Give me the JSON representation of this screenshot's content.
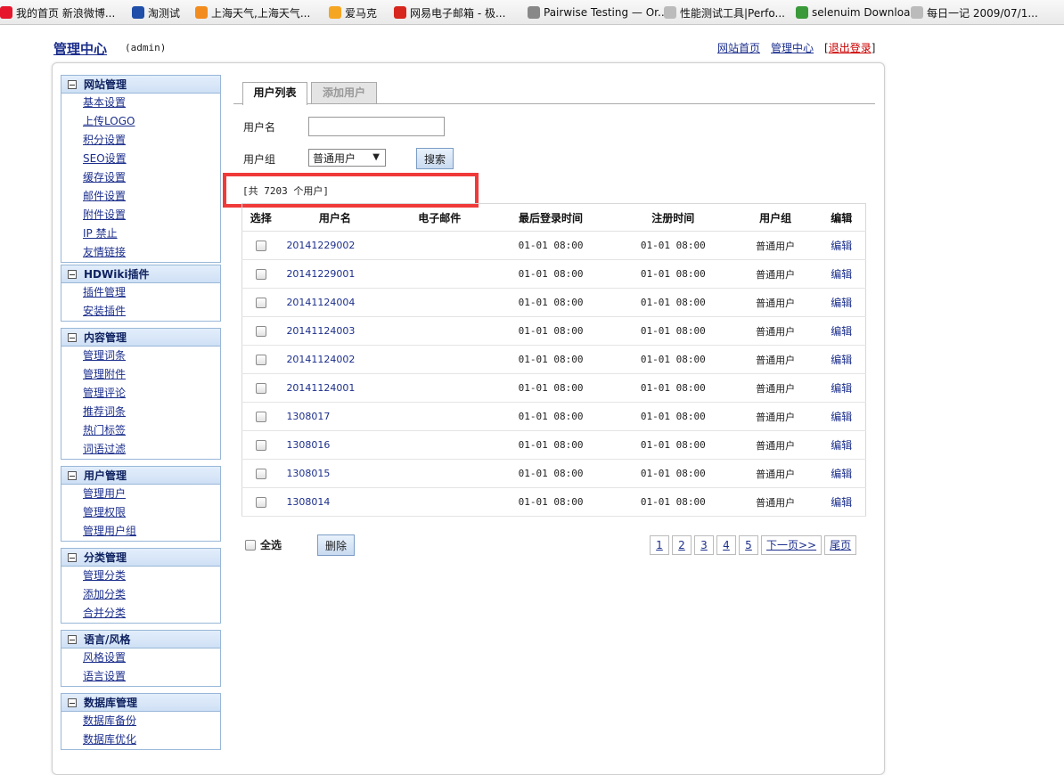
{
  "bookmarks": [
    {
      "label": "我的首页 新浪微博...",
      "icon": "weibo-icon",
      "color": "#e6162d"
    },
    {
      "label": "淘测试",
      "icon": "taobao-icon",
      "color": "#1f4fa8"
    },
    {
      "label": "上海天气,上海天气...",
      "icon": "weather-icon",
      "color": "#f28c1e"
    },
    {
      "label": "爱马克",
      "icon": "amark-icon",
      "color": "#f5a623"
    },
    {
      "label": "网易电子邮箱 - 极...",
      "icon": "netease-icon",
      "color": "#d6261e"
    },
    {
      "label": "Pairwise Testing — Or...",
      "icon": "pairwise-icon",
      "color": "#888888"
    },
    {
      "label": "性能测试工具|Perfo...",
      "icon": "page-icon",
      "color": "#bbbbbb"
    },
    {
      "label": "selenuim Downloads",
      "icon": "check-icon",
      "color": "#3a9a3a"
    },
    {
      "label": "每日一记 2009/07/1...",
      "icon": "page-icon",
      "color": "#bbbbbb"
    }
  ],
  "header": {
    "title": "管理中心",
    "user": "(admin)",
    "links": {
      "home": "网站首页",
      "admin": "管理中心",
      "bracket_open": "[",
      "logout": "退出登录",
      "bracket_close": "]"
    }
  },
  "sidebar": [
    {
      "title": "网站管理",
      "items": [
        "基本设置",
        "上传LOGO",
        "积分设置",
        "SEO设置",
        "缓存设置",
        "邮件设置",
        "附件设置",
        "IP 禁止",
        "友情链接"
      ]
    },
    {
      "title": "HDWiki插件",
      "items": [
        "插件管理",
        "安装插件"
      ]
    },
    {
      "title": "内容管理",
      "items": [
        "管理词条",
        "管理附件",
        "管理评论",
        "推荐词条",
        "热门标签",
        "词语过滤"
      ]
    },
    {
      "title": "用户管理",
      "items": [
        "管理用户",
        "管理权限",
        "管理用户组"
      ]
    },
    {
      "title": "分类管理",
      "items": [
        "管理分类",
        "添加分类",
        "合并分类"
      ]
    },
    {
      "title": "语言/风格",
      "items": [
        "风格设置",
        "语言设置"
      ]
    },
    {
      "title": "数据库管理",
      "items": [
        "数据库备份",
        "数据库优化"
      ]
    }
  ],
  "tabs": {
    "list": "用户列表",
    "add": "添加用户"
  },
  "search": {
    "username_label": "用户名",
    "username_value": "",
    "group_label": "用户组",
    "group_selected": "普通用户",
    "search_button": "搜索"
  },
  "count_text": "[共 7203 个用户]",
  "table": {
    "headers": [
      "选择",
      "用户名",
      "电子邮件",
      "最后登录时间",
      "注册时间",
      "用户组",
      "编辑"
    ],
    "rows": [
      {
        "username": "20141229002",
        "email": "",
        "last_login": "01-01 08:00",
        "registered": "01-01 08:00",
        "group": "普通用户",
        "edit": "编辑"
      },
      {
        "username": "20141229001",
        "email": "",
        "last_login": "01-01 08:00",
        "registered": "01-01 08:00",
        "group": "普通用户",
        "edit": "编辑"
      },
      {
        "username": "20141124004",
        "email": "",
        "last_login": "01-01 08:00",
        "registered": "01-01 08:00",
        "group": "普通用户",
        "edit": "编辑"
      },
      {
        "username": "20141124003",
        "email": "",
        "last_login": "01-01 08:00",
        "registered": "01-01 08:00",
        "group": "普通用户",
        "edit": "编辑"
      },
      {
        "username": "20141124002",
        "email": "",
        "last_login": "01-01 08:00",
        "registered": "01-01 08:00",
        "group": "普通用户",
        "edit": "编辑"
      },
      {
        "username": "20141124001",
        "email": "",
        "last_login": "01-01 08:00",
        "registered": "01-01 08:00",
        "group": "普通用户",
        "edit": "编辑"
      },
      {
        "username": "1308017",
        "email": "",
        "last_login": "01-01 08:00",
        "registered": "01-01 08:00",
        "group": "普通用户",
        "edit": "编辑"
      },
      {
        "username": "1308016",
        "email": "",
        "last_login": "01-01 08:00",
        "registered": "01-01 08:00",
        "group": "普通用户",
        "edit": "编辑"
      },
      {
        "username": "1308015",
        "email": "",
        "last_login": "01-01 08:00",
        "registered": "01-01 08:00",
        "group": "普通用户",
        "edit": "编辑"
      },
      {
        "username": "1308014",
        "email": "",
        "last_login": "01-01 08:00",
        "registered": "01-01 08:00",
        "group": "普通用户",
        "edit": "编辑"
      }
    ]
  },
  "footer": {
    "select_all": "全选",
    "delete_button": "删除",
    "pages": [
      "1",
      "2",
      "3",
      "4",
      "5"
    ],
    "next": "下一页>>",
    "last": "尾页"
  }
}
